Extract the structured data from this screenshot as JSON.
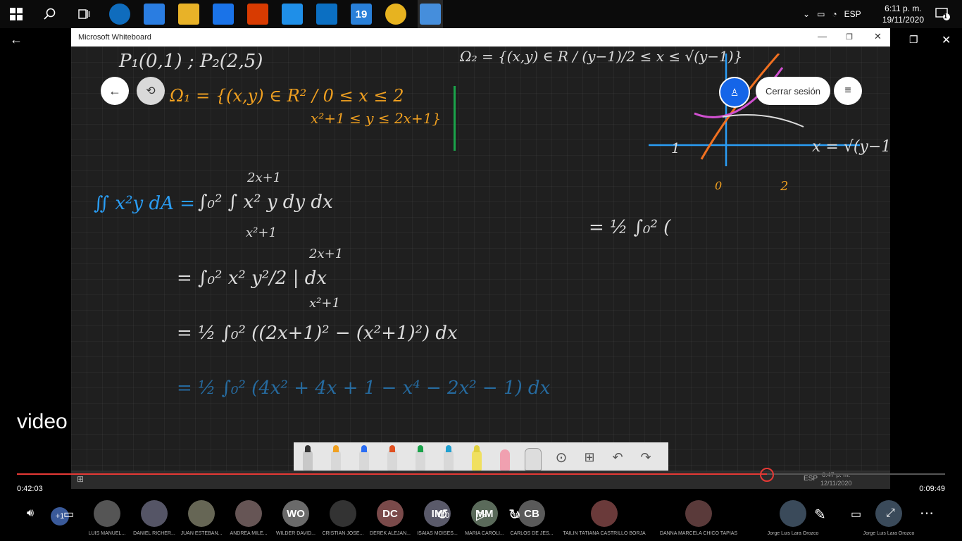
{
  "top_taskbar": {
    "pinned_apps": [
      {
        "name": "edge",
        "label": ""
      },
      {
        "name": "store",
        "label": ""
      },
      {
        "name": "file-explorer",
        "label": ""
      },
      {
        "name": "mail",
        "label": ""
      },
      {
        "name": "office",
        "label": ""
      },
      {
        "name": "phone",
        "label": ""
      },
      {
        "name": "vscode",
        "label": ""
      },
      {
        "name": "app-19",
        "label": "19"
      },
      {
        "name": "chrome",
        "label": ""
      },
      {
        "name": "video-app",
        "label": ""
      }
    ],
    "language": "ESP",
    "time": "6:11 p. m.",
    "date": "19/11/2020",
    "notifications_count": "1"
  },
  "whiteboard": {
    "title": "Microsoft Whiteboard",
    "signout_label": "Cerrar sesión"
  },
  "handwriting": {
    "points": "P₁(0,1) ; P₂(2,5)",
    "region1_label": "Ω₁ = {(x,y) ∈ R² / 0 ≤ x ≤ 2",
    "region1_cond": "x²+1 ≤ y ≤ 2x+1}",
    "region2": "Ω₂ = {(x,y) ∈ R / (y−1)/2 ≤ x ≤ √(y−1)}",
    "graph_label_x": "x = √(y−1)",
    "graph_label_2": "2",
    "graph_label_0": "0",
    "graph_label_1": "1",
    "integral_lhs": "∬ x²y dA =",
    "integral_rhs": "∫₀² ∫ x² y dy dx",
    "upper_limit_1": "2x+1",
    "lower_limit_1": "x²+1",
    "line2": "= ∫₀² x² y²/2 | dx",
    "line2_upper": "2x+1",
    "line2_lower": "x²+1",
    "line3": "= ½ ∫₀² ((2x+1)² − (x²+1)²) dx",
    "line4": "= ½ ∫₀² (4x² + 4x + 1 − x⁴ − 2x² − 1) dx",
    "right_expr": "= ½ ∫₀² ("
  },
  "inner_taskbar": {
    "time": "6:47 p. m.",
    "date": "12/11/2020",
    "language": "ESP"
  },
  "player": {
    "overlay_text": "video",
    "elapsed": "0:42:03",
    "remaining": "0:09:49",
    "progress_fraction": 0.808,
    "skip_back": "10",
    "skip_forward": "30",
    "extra_count": "+1"
  },
  "participants": [
    {
      "initials": "",
      "name": "LUIS MANUEL...",
      "color": "#555"
    },
    {
      "initials": "",
      "name": "DANIEL RICHER...",
      "color": "#556"
    },
    {
      "initials": "",
      "name": "JUAN ESTEBAN...",
      "color": "#665"
    },
    {
      "initials": "",
      "name": "ANDREA MILE...",
      "color": "#655"
    },
    {
      "initials": "WO",
      "name": "WILDER DAVID...",
      "color": "#6a6a6a"
    },
    {
      "initials": "",
      "name": "CRISTIAN JOSE...",
      "color": "#333"
    },
    {
      "initials": "DC",
      "name": "DEREK ALEJAN...",
      "color": "#7a4a4a"
    },
    {
      "initials": "IM",
      "name": "ISAIAS MOISES...",
      "color": "#5a5a6a"
    },
    {
      "initials": "MM",
      "name": "MARIA CAROLI...",
      "color": "#5a6a5a"
    },
    {
      "initials": "CB",
      "name": "CARLOS DE JES...",
      "color": "#5a5a5a"
    }
  ],
  "featured_participants": [
    {
      "name": "TAILIN TATIANA CASTRILLO BORJA"
    },
    {
      "name": "DANNA MARCELA CHICO TAPIAS"
    },
    {
      "name": "Jorge Luis Lara Orozco"
    },
    {
      "name": "Jorge Luis Lara Orozco"
    }
  ],
  "colors": {
    "accent": "#e53935",
    "ink_white": "#dcdcdc",
    "ink_orange": "#f0a020",
    "ink_blue": "#2a9df4",
    "ink_green": "#1aa34a",
    "ink_purple": "#d050d0"
  }
}
